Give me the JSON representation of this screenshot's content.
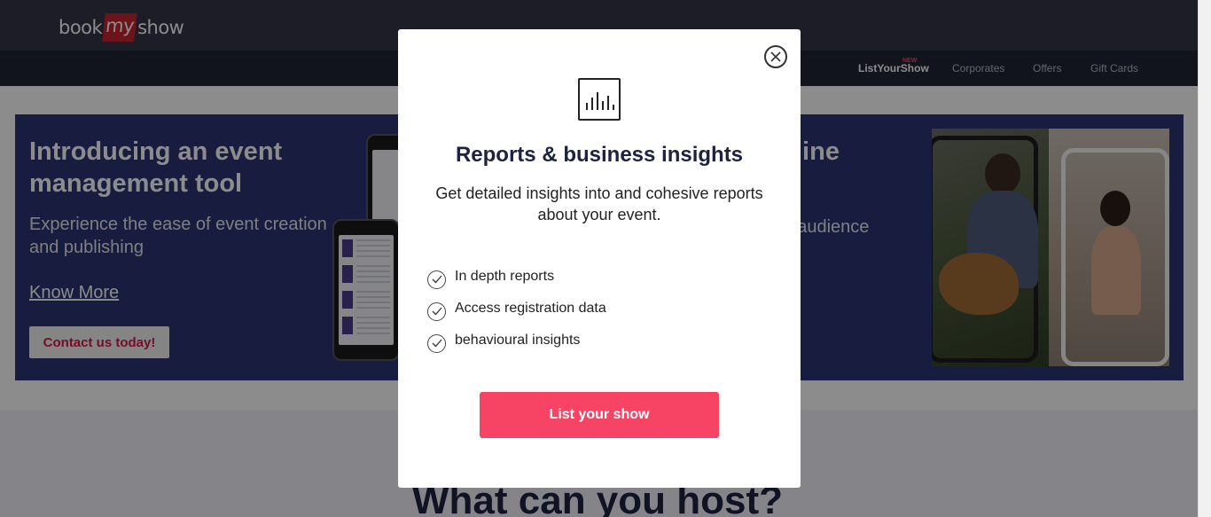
{
  "header": {
    "logo_book": "book",
    "logo_my": "my",
    "logo_show": "show"
  },
  "subnav": {
    "items": [
      {
        "label": "ListYourShow",
        "badge": "NEW"
      },
      {
        "label": "Corporates"
      },
      {
        "label": "Offers"
      },
      {
        "label": "Gift Cards"
      }
    ]
  },
  "banner": {
    "heading": "Introducing an event management tool",
    "subheading": "Experience the ease of event creation and publishing",
    "know_more": "Know More",
    "contact": "Contact us today!",
    "right_heading_fragment": "line",
    "right_sub_fragment": "r audience"
  },
  "section": {
    "title": "What can you host?"
  },
  "modal": {
    "icon": "bar-chart-icon",
    "title": "Reports & business insights",
    "description": "Get detailed insights into and cohesive reports about your event.",
    "features": [
      "In depth reports",
      "Access registration data",
      "behavioural insights"
    ],
    "cta_label": "List your show",
    "close_icon": "close-icon"
  },
  "colors": {
    "accent": "#f84464",
    "brand_red": "#c4242d",
    "header_bg": "#333545",
    "subnav_bg": "#1f2533",
    "banner_bg": "#2b3270"
  }
}
